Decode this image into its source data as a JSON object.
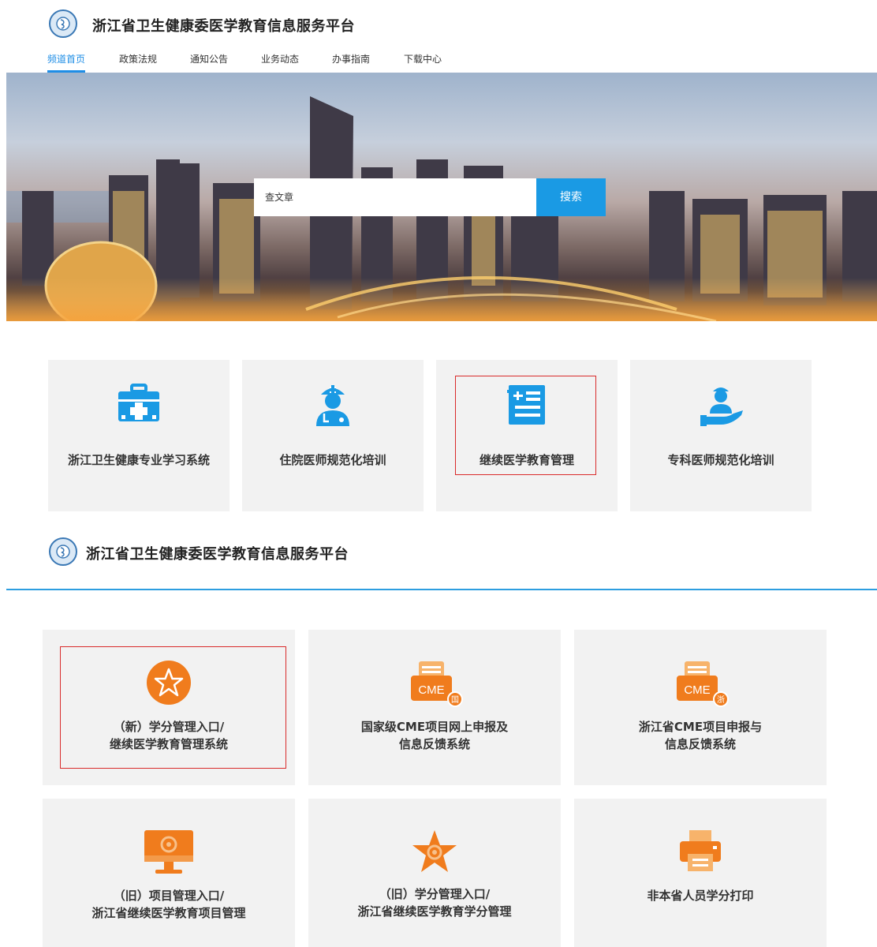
{
  "header": {
    "title": "浙江省卫生健康委医学教育信息服务平台"
  },
  "nav": [
    "频道首页",
    "政策法规",
    "通知公告",
    "业务动态",
    "办事指南",
    "下载中心"
  ],
  "search": {
    "value": "查文章",
    "button": "搜索"
  },
  "platforms": [
    {
      "label": "浙江卫生健康专业学习系统",
      "icon": "medical-kit-icon"
    },
    {
      "label": "住院医师规范化培训",
      "icon": "doctor-icon"
    },
    {
      "label": "继续医学教育管理",
      "icon": "list-icon"
    },
    {
      "label": "专科医师规范化培训",
      "icon": "hand-doctor-icon"
    }
  ],
  "section2": {
    "title": "浙江省卫生健康委医学教育信息服务平台"
  },
  "systems": [
    {
      "line1": "（新）学分管理入口/",
      "line2": "继续医学教育管理系统",
      "icon": "star-circle-icon"
    },
    {
      "line1": "国家级CME项目网上申报及",
      "line2": "信息反馈系统",
      "icon": "cme-national-icon",
      "icon_text": "CME",
      "badge": "国"
    },
    {
      "line1": "浙江省CME项目申报与",
      "line2": "信息反馈系统",
      "icon": "cme-province-icon",
      "icon_text": "CME",
      "badge": "浙"
    },
    {
      "line1": "（旧）项目管理入口/",
      "line2": "浙江省继续医学教育项目管理",
      "icon": "monitor-icon"
    },
    {
      "line1": "（旧）学分管理入口/",
      "line2": "浙江省继续医学教育学分管理",
      "icon": "star-gear-icon"
    },
    {
      "line1": "非本省人员学分打印",
      "line2": "",
      "icon": "printer-icon"
    }
  ],
  "colors": {
    "accent": "#1f8ee6",
    "orange": "#f07c1d",
    "highlight": "#d92b2b"
  }
}
